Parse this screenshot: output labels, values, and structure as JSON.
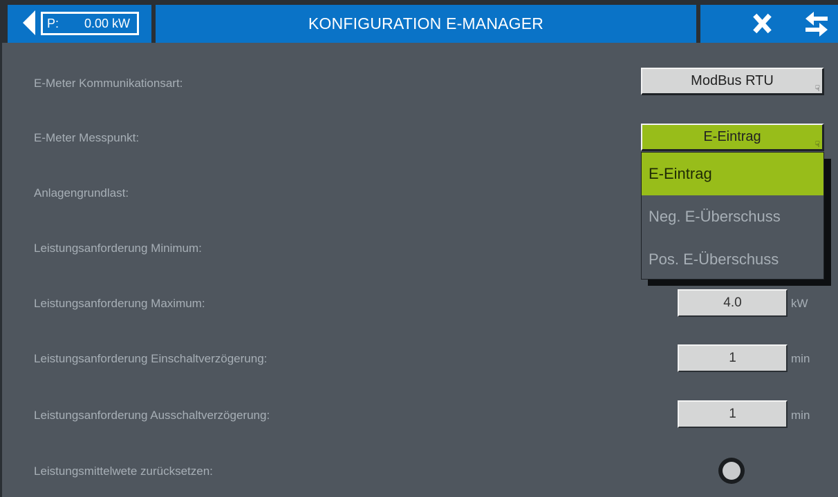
{
  "header": {
    "power_label": "P:",
    "power_value": "0.00 kW",
    "title": "KONFIGURATION E-MANAGER"
  },
  "rows": {
    "comm_type": {
      "label": "E-Meter Kommunikationsart:",
      "value": "ModBus RTU"
    },
    "measure_point": {
      "label": "E-Meter Messpunkt:",
      "value": "E-Eintrag"
    },
    "base_load": {
      "label": "Anlagengrundlast:"
    },
    "power_min": {
      "label": "Leistungsanforderung Minimum:"
    },
    "power_max": {
      "label": "Leistungsanforderung Maximum:",
      "value": "4.0",
      "unit": "kW"
    },
    "on_delay": {
      "label": "Leistungsanforderung Einschaltverzögerung:",
      "value": "1",
      "unit": "min"
    },
    "off_delay": {
      "label": "Leistungsanforderung Ausschaltverzögerung:",
      "value": "1",
      "unit": "min"
    },
    "reset_avg": {
      "label": "Leistungsmittelwete zurücksetzen:"
    }
  },
  "dropdown": {
    "selected": "E-Eintrag",
    "options": [
      "E-Eintrag",
      "Neg. E-Überschuss",
      "Pos. E-Überschuss"
    ]
  },
  "colors": {
    "header_blue": "#0a73c7",
    "accent_green": "#98bd1a",
    "background": "#4f565e",
    "label_text": "#a7afb6"
  },
  "icons": {
    "back": "back-arrow-icon",
    "close": "close-icon",
    "swap": "swap-arrows-icon",
    "select_hint": "edit-hand-icon"
  }
}
